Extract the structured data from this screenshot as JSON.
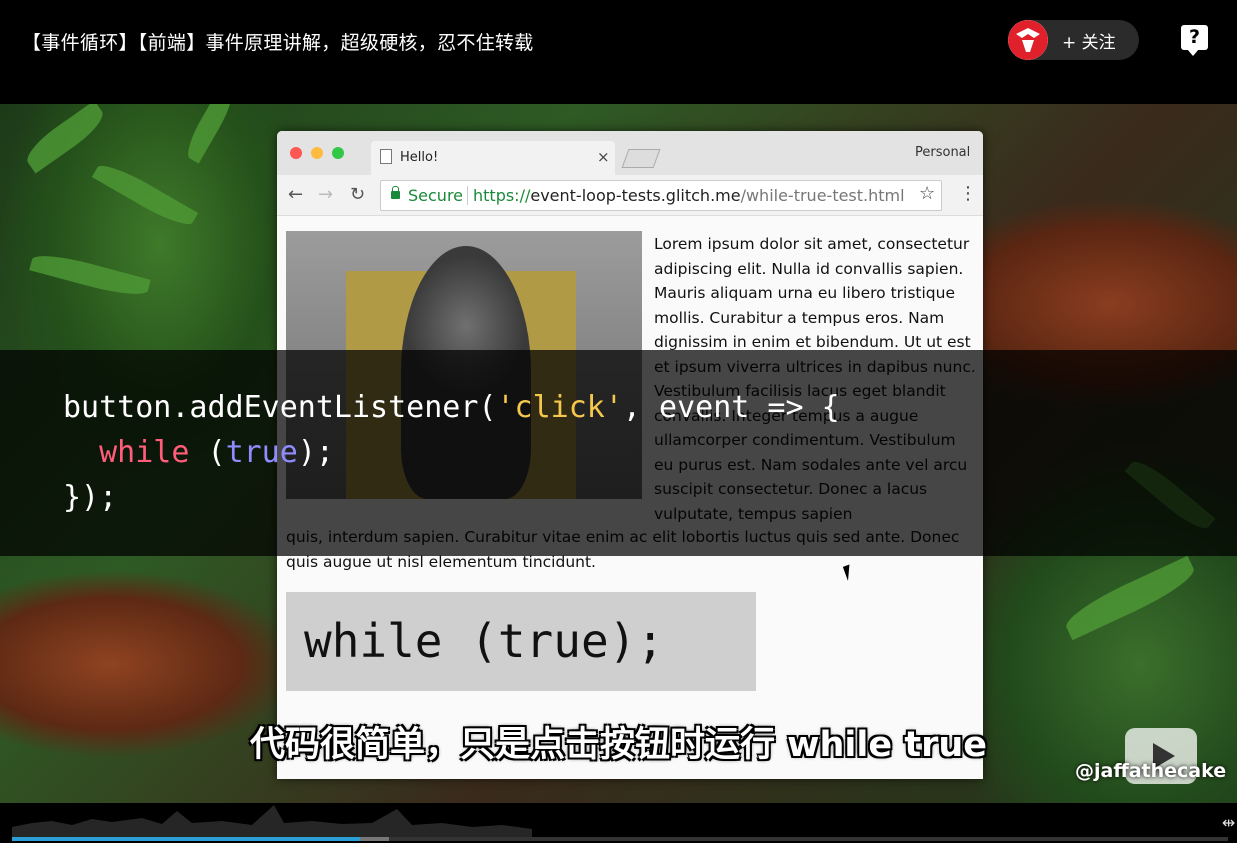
{
  "header": {
    "title": "【事件循环】【前端】事件原理讲解，超级硬核，忍不住转载",
    "follow_label": "+ 关注",
    "help_label": "?"
  },
  "browser": {
    "tab_title": "Hello!",
    "tab_close": "×",
    "profile": "Personal",
    "secure_label": "Secure",
    "url_scheme": "https://",
    "url_host": "event-loop-tests.glitch.me",
    "url_path": "/while-true-test.html",
    "paragraph_right": "Lorem ipsum dolor sit amet, consectetur adipiscing elit. Nulla id convallis sapien. Mauris aliquam urna eu libero tristique mollis. Curabitur a tempus eros. Nam dignissim in enim et bibendum. Ut ut est et ipsum viverra ultrices in dapibus nunc. Vestibulum facilisis lacus eget blandit convallis. Integer tempus a augue ullamcorper condimentum. Vestibulum eu purus est. Nam sodales ante vel arcu suscipit consectetur. Donec a lacus vulputate, tempus sapien",
    "paragraph_full": "quis, interdum sapien. Curabitur vitae enim ac elit lobortis luctus quis sed ante. Donec quis augue ut nisl elementum tincidunt.",
    "code_image_text": "while (true);"
  },
  "code_overlay": {
    "line1_a": "button.addEventListener(",
    "line1_str": "'click'",
    "line1_b": ", event => {",
    "line2_kw": "while",
    "line2_a": " (",
    "line2_bool": "true",
    "line2_b": ");",
    "line3": "});"
  },
  "video": {
    "subtitle": "代码很简单，只是点击按钮时运行 while true",
    "watermark_handle": "@jaffathecake"
  },
  "player": {
    "progress": 0.286,
    "buffered": 0.31,
    "accent_color": "#2a9fd6"
  }
}
